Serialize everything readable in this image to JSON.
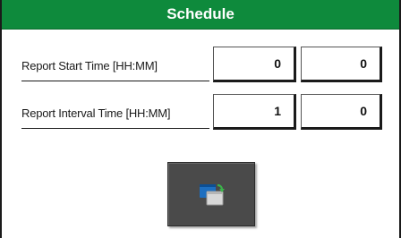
{
  "window": {
    "title": "Schedule"
  },
  "rows": [
    {
      "label": "Report Start Time [HH:MM]",
      "hours": "0",
      "minutes": "0"
    },
    {
      "label": "Report Interval Time [HH:MM]",
      "hours": "1",
      "minutes": "0"
    }
  ],
  "action_button": {
    "icon": "copy-windows-icon"
  },
  "colors": {
    "title_bar": "#0e8a3c",
    "button_bg": "#4a4a4a",
    "icon_blue": "#1e6fc0",
    "icon_green": "#3bb34a"
  }
}
